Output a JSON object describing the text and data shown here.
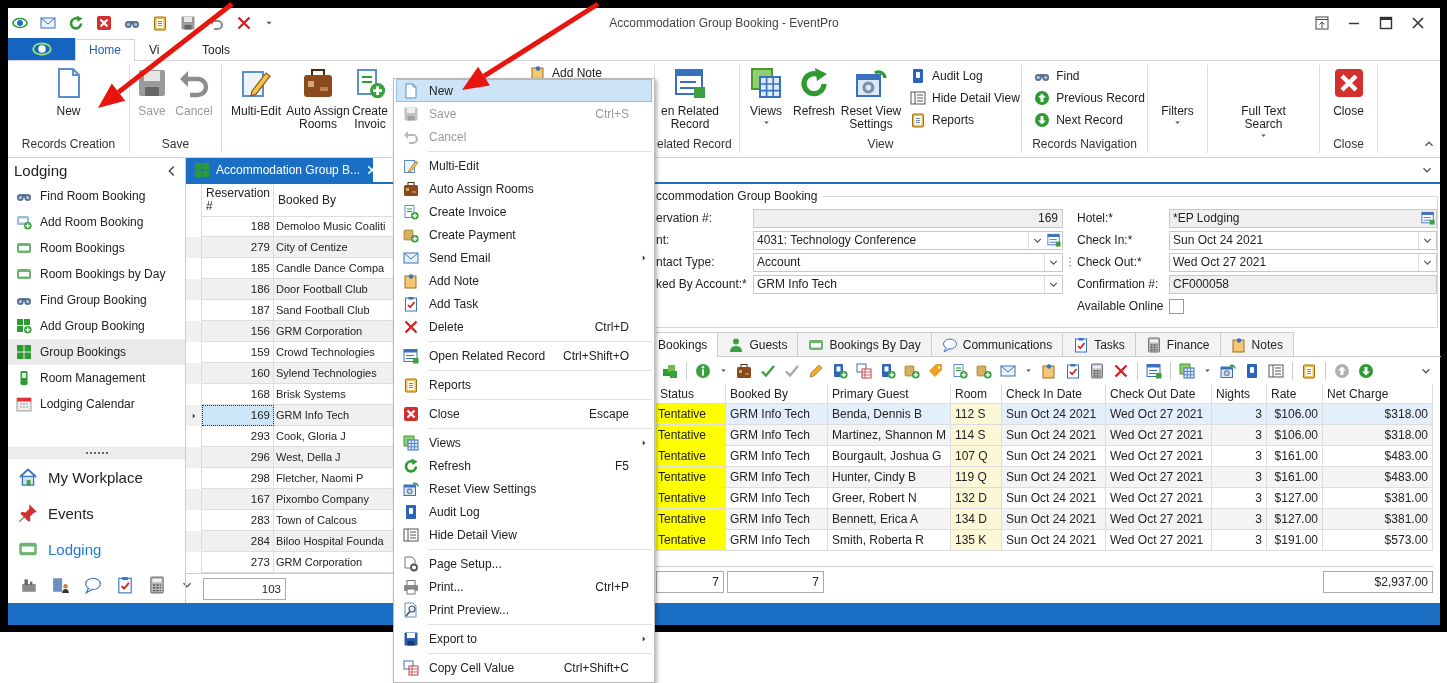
{
  "window": {
    "title": "Accommodation Group Booking - EventPro"
  },
  "ribbon_tabs": [
    {
      "label": "Home",
      "selected": true
    },
    {
      "label": "Vi",
      "selected": false
    },
    {
      "label": "Tools",
      "selected": false
    }
  ],
  "ribbon_groups": [
    {
      "label": "Records Creation",
      "items": [
        {
          "kind": "large",
          "label": "New",
          "disabled": false,
          "dropdown": false
        }
      ]
    },
    {
      "label": "Save",
      "items": [
        {
          "kind": "large",
          "label": "Save",
          "disabled": true,
          "dropdown": false
        },
        {
          "kind": "large",
          "label": "Cancel",
          "disabled": true,
          "dropdown": false
        }
      ]
    },
    {
      "items": [
        {
          "kind": "large",
          "label": "Multi-Edit",
          "disabled": false,
          "dropdown": false
        },
        {
          "kind": "large",
          "label": "Auto Assign Rooms",
          "disabled": false,
          "dropdown": false
        },
        {
          "kind": "large",
          "label": "Create Invoic",
          "disabled": false,
          "dropdown": false
        },
        {
          "kind": "small",
          "label": "Add Note",
          "disabled": false,
          "dropdown": false
        }
      ]
    },
    {
      "label": "elated Record",
      "items": [
        {
          "kind": "large",
          "label": "en Related Record",
          "disabled": false,
          "dropdown": false
        }
      ]
    },
    {
      "label": "View",
      "items": [
        {
          "kind": "large",
          "label": "Views",
          "disabled": false,
          "dropdown": true
        },
        {
          "kind": "large",
          "label": "Refresh",
          "disabled": false,
          "dropdown": false
        },
        {
          "kind": "large",
          "label": "Reset View Settings",
          "disabled": false,
          "dropdown": false
        },
        {
          "kind": "small",
          "label": "Audit Log",
          "disabled": false,
          "dropdown": false
        },
        {
          "kind": "small",
          "label": "Hide Detail View",
          "disabled": false,
          "dropdown": false
        },
        {
          "kind": "small",
          "label": "Reports",
          "disabled": false,
          "dropdown": false
        }
      ]
    },
    {
      "label": "Records Navigation",
      "items": [
        {
          "kind": "small",
          "label": "Find",
          "disabled": false,
          "dropdown": false
        },
        {
          "kind": "small",
          "label": "Previous Record",
          "disabled": false,
          "dropdown": false
        },
        {
          "kind": "small",
          "label": "Next Record",
          "disabled": false,
          "dropdown": false
        }
      ]
    },
    {
      "items": [
        {
          "kind": "large",
          "label": "Filters",
          "disabled": false,
          "dropdown": true
        }
      ]
    },
    {
      "items": [
        {
          "kind": "large",
          "label": "Full Text Search",
          "disabled": false,
          "dropdown": true
        }
      ]
    },
    {
      "label": "Close",
      "items": [
        {
          "kind": "large",
          "label": "Close",
          "disabled": false,
          "dropdown": false
        }
      ]
    }
  ],
  "nav": {
    "title": "Lodging",
    "items": [
      {
        "label": "Find Room Booking",
        "selected": false
      },
      {
        "label": "Add Room Booking",
        "selected": false
      },
      {
        "label": "Room Bookings",
        "selected": false
      },
      {
        "label": "Room Bookings by Day",
        "selected": false
      },
      {
        "label": "Find Group Booking",
        "selected": false
      },
      {
        "label": "Add Group Booking",
        "selected": false
      },
      {
        "label": "Group Bookings",
        "selected": true
      },
      {
        "label": "Room Management",
        "selected": false
      },
      {
        "label": "Lodging Calendar",
        "selected": false
      }
    ],
    "modules": [
      {
        "label": "My Workplace",
        "selected": false
      },
      {
        "label": "Events",
        "selected": false
      },
      {
        "label": "Lodging",
        "selected": true
      }
    ]
  },
  "document_tab": {
    "title": "Accommodation Group B..."
  },
  "group_list": {
    "columns": [
      "Reservation #",
      "Booked By"
    ],
    "rows": [
      {
        "reservation": "188",
        "booked_by": "Demoloo Music Coaliti",
        "selected": false
      },
      {
        "reservation": "279",
        "booked_by": "City of Centize",
        "selected": false
      },
      {
        "reservation": "185",
        "booked_by": "Candle Dance Compa",
        "selected": false
      },
      {
        "reservation": "186",
        "booked_by": "Door Football Club",
        "selected": false
      },
      {
        "reservation": "187",
        "booked_by": "Sand Football Club",
        "selected": false
      },
      {
        "reservation": "156",
        "booked_by": "GRM Corporation",
        "selected": false
      },
      {
        "reservation": "159",
        "booked_by": "Crowd Technologies",
        "selected": false
      },
      {
        "reservation": "160",
        "booked_by": "Sylend Technologies",
        "selected": false
      },
      {
        "reservation": "168",
        "booked_by": "Brisk Systems",
        "selected": false
      },
      {
        "reservation": "169",
        "booked_by": "GRM Info Tech",
        "selected": true
      },
      {
        "reservation": "293",
        "booked_by": "Cook, Gloria J",
        "selected": false
      },
      {
        "reservation": "296",
        "booked_by": "West, Della J",
        "selected": false
      },
      {
        "reservation": "298",
        "booked_by": "Fletcher, Naomi P",
        "selected": false
      },
      {
        "reservation": "167",
        "booked_by": "Pixombo Company",
        "selected": false
      },
      {
        "reservation": "283",
        "booked_by": "Town of Calcous",
        "selected": false
      },
      {
        "reservation": "284",
        "booked_by": "Biloo Hospital Founda",
        "selected": false
      },
      {
        "reservation": "273",
        "booked_by": "GRM Corporation",
        "selected": false
      }
    ],
    "footer": "103"
  },
  "detail": {
    "title": "ccommodation Group Booking",
    "left_fields": [
      {
        "label": "ervation #:",
        "kind": "number",
        "value": "169"
      },
      {
        "label": "nt:",
        "kind": "combo_lookup",
        "value": "4031: Technology Conference"
      },
      {
        "label": "ntact Type:",
        "kind": "combo",
        "value": "Account"
      },
      {
        "label": "ked By Account:*",
        "kind": "combo",
        "value": "GRM Info Tech"
      }
    ],
    "right_fields": [
      {
        "label": "Hotel:*",
        "kind": "text_lookup",
        "value": "*EP Lodging"
      },
      {
        "label": "Check In:*",
        "kind": "combo",
        "value": "Sun Oct 24 2021"
      },
      {
        "label": "Check Out:*",
        "kind": "combo",
        "value": "Wed Oct 27 2021"
      },
      {
        "label": "Confirmation #:",
        "kind": "text",
        "value": "CF000058"
      },
      {
        "label": "Available Online",
        "kind": "checkbox",
        "checked": false
      }
    ]
  },
  "detail_tabs": [
    {
      "label": "Bookings",
      "selected": true
    },
    {
      "label": "Guests",
      "selected": false
    },
    {
      "label": "Bookings By Day",
      "selected": false
    },
    {
      "label": "Communications",
      "selected": false
    },
    {
      "label": "Tasks",
      "selected": false
    },
    {
      "label": "Finance",
      "selected": false
    },
    {
      "label": "Notes",
      "selected": false
    }
  ],
  "bookings": {
    "columns": [
      "Status",
      "Booked By",
      "Primary Guest",
      "Room",
      "Check In Date",
      "Check Out Date",
      "Nights",
      "Rate",
      "Net Charge"
    ],
    "rows": [
      {
        "status": "Tentative",
        "booked_by": "GRM Info Tech",
        "guest": "Benda, Dennis B",
        "room": "112 S",
        "check_in": "Sun Oct 24 2021",
        "check_out": "Wed Oct 27 2021",
        "nights": "3",
        "rate": "$106.00",
        "net": "$318.00",
        "selected": true
      },
      {
        "status": "Tentative",
        "booked_by": "GRM Info Tech",
        "guest": "Martinez, Shannon M",
        "room": "114 S",
        "check_in": "Sun Oct 24 2021",
        "check_out": "Wed Oct 27 2021",
        "nights": "3",
        "rate": "$106.00",
        "net": "$318.00",
        "selected": false
      },
      {
        "status": "Tentative",
        "booked_by": "GRM Info Tech",
        "guest": "Bourgault, Joshua G",
        "room": "107 Q",
        "check_in": "Sun Oct 24 2021",
        "check_out": "Wed Oct 27 2021",
        "nights": "3",
        "rate": "$161.00",
        "net": "$483.00",
        "selected": false
      },
      {
        "status": "Tentative",
        "booked_by": "GRM Info Tech",
        "guest": "Hunter, Cindy B",
        "room": "119 Q",
        "check_in": "Sun Oct 24 2021",
        "check_out": "Wed Oct 27 2021",
        "nights": "3",
        "rate": "$161.00",
        "net": "$483.00",
        "selected": false
      },
      {
        "status": "Tentative",
        "booked_by": "GRM Info Tech",
        "guest": "Greer, Robert N",
        "room": "132 D",
        "check_in": "Sun Oct 24 2021",
        "check_out": "Wed Oct 27 2021",
        "nights": "3",
        "rate": "$127.00",
        "net": "$381.00",
        "selected": false
      },
      {
        "status": "Tentative",
        "booked_by": "GRM Info Tech",
        "guest": "Bennett, Erica A",
        "room": "134 D",
        "check_in": "Sun Oct 24 2021",
        "check_out": "Wed Oct 27 2021",
        "nights": "3",
        "rate": "$127.00",
        "net": "$381.00",
        "selected": false
      },
      {
        "status": "Tentative",
        "booked_by": "GRM Info Tech",
        "guest": "Smith, Roberta R",
        "room": "135 K",
        "check_in": "Sun Oct 24 2021",
        "check_out": "Wed Oct 27 2021",
        "nights": "3",
        "rate": "$191.00",
        "net": "$573.00",
        "selected": false
      }
    ],
    "footer": [
      "7",
      "7",
      "$2,937.00"
    ]
  },
  "context_menu": [
    {
      "kind": "item",
      "label": "New",
      "selected": true,
      "disabled": false,
      "submenu": false
    },
    {
      "kind": "item",
      "label": "Save",
      "shortcut": "Ctrl+S",
      "selected": false,
      "disabled": true,
      "submenu": false
    },
    {
      "kind": "item",
      "label": "Cancel",
      "selected": false,
      "disabled": true,
      "submenu": false
    },
    {
      "kind": "separator"
    },
    {
      "kind": "item",
      "label": "Multi-Edit",
      "selected": false,
      "disabled": false,
      "submenu": false
    },
    {
      "kind": "item",
      "label": "Auto Assign Rooms",
      "selected": false,
      "disabled": false,
      "submenu": false
    },
    {
      "kind": "item",
      "label": "Create Invoice",
      "selected": false,
      "disabled": false,
      "submenu": false
    },
    {
      "kind": "item",
      "label": "Create Payment",
      "selected": false,
      "disabled": false,
      "submenu": false
    },
    {
      "kind": "item",
      "label": "Send Email",
      "selected": false,
      "disabled": false,
      "submenu": true
    },
    {
      "kind": "item",
      "label": "Add Note",
      "selected": false,
      "disabled": false,
      "submenu": false
    },
    {
      "kind": "item",
      "label": "Add Task",
      "selected": false,
      "disabled": false,
      "submenu": false
    },
    {
      "kind": "item",
      "label": "Delete",
      "shortcut": "Ctrl+D",
      "selected": false,
      "disabled": false,
      "submenu": false
    },
    {
      "kind": "separator"
    },
    {
      "kind": "item",
      "label": "Open Related Record",
      "shortcut": "Ctrl+Shift+O",
      "selected": false,
      "disabled": false,
      "submenu": false
    },
    {
      "kind": "separator"
    },
    {
      "kind": "item",
      "label": "Reports",
      "selected": false,
      "disabled": false,
      "submenu": false
    },
    {
      "kind": "separator"
    },
    {
      "kind": "item",
      "label": "Close",
      "shortcut": "Escape",
      "selected": false,
      "disabled": false,
      "submenu": false
    },
    {
      "kind": "separator"
    },
    {
      "kind": "item",
      "label": "Views",
      "selected": false,
      "disabled": false,
      "submenu": true
    },
    {
      "kind": "item",
      "label": "Refresh",
      "shortcut": "F5",
      "selected": false,
      "disabled": false,
      "submenu": false
    },
    {
      "kind": "item",
      "label": "Reset View Settings",
      "selected": false,
      "disabled": false,
      "submenu": false
    },
    {
      "kind": "item",
      "label": "Audit Log",
      "selected": false,
      "disabled": false,
      "submenu": false
    },
    {
      "kind": "item",
      "label": "Hide Detail View",
      "selected": false,
      "disabled": false,
      "submenu": false
    },
    {
      "kind": "separator"
    },
    {
      "kind": "item",
      "label": "Page Setup...",
      "selected": false,
      "disabled": false,
      "submenu": false
    },
    {
      "kind": "item",
      "label": "Print...",
      "shortcut": "Ctrl+P",
      "selected": false,
      "disabled": false,
      "submenu": false
    },
    {
      "kind": "item",
      "label": "Print Preview...",
      "selected": false,
      "disabled": false,
      "submenu": false
    },
    {
      "kind": "separator"
    },
    {
      "kind": "item",
      "label": "Export to",
      "selected": false,
      "disabled": false,
      "submenu": true
    },
    {
      "kind": "separator"
    },
    {
      "kind": "item",
      "label": "Copy Cell Value",
      "shortcut": "Ctrl+Shift+C",
      "selected": false,
      "disabled": false,
      "submenu": false
    }
  ]
}
